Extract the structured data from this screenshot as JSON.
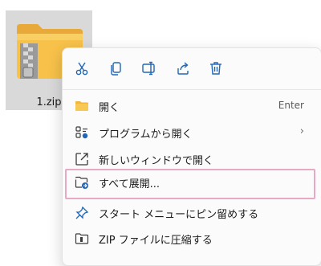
{
  "file": {
    "name": "1.zip"
  },
  "toolbar": {
    "cut": "scissors-icon",
    "copy": "copy-icon",
    "rename": "rename-icon",
    "share": "share-icon",
    "delete": "trash-icon",
    "icon_color": "#2266b8"
  },
  "menu": {
    "items": [
      {
        "label": "開く",
        "shortcut": "Enter",
        "icon": "folder-icon"
      },
      {
        "label": "プログラムから開く",
        "icon": "open-with-icon",
        "has_submenu": true
      },
      {
        "label": "新しいウィンドウで開く",
        "icon": "new-window-icon"
      },
      {
        "label": "すべて展開...",
        "icon": "extract-icon",
        "highlighted": true,
        "highlight_color": "#e7a9c4"
      },
      {
        "label": "スタート メニューにピン留めする",
        "icon": "pin-icon"
      },
      {
        "label": "ZIP ファイルに圧縮する",
        "icon": "compress-icon"
      }
    ]
  }
}
